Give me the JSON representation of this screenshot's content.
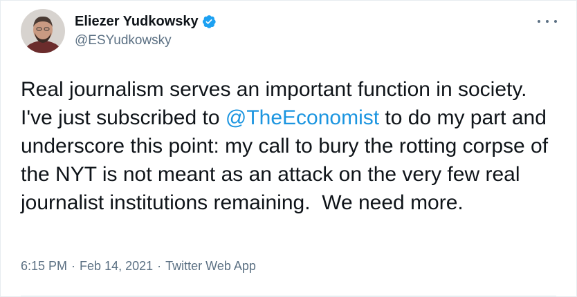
{
  "author": {
    "display_name": "Eliezer Yudkowsky",
    "handle": "@ESYudkowsky",
    "verified": true,
    "avatar_icon": "user-avatar"
  },
  "tweet": {
    "text_before": "Real journalism serves an important function in society. I've just subscribed to ",
    "mention": "@TheEconomist",
    "text_after": " to do my part and underscore this point: my call to bury the rotting corpse of the NYT is not meant as an attack on the very few real journalist institutions remaining.  We need more."
  },
  "meta": {
    "time": "6:15 PM",
    "separator": "·",
    "date": "Feb 14, 2021",
    "source": "Twitter Web App"
  },
  "icons": {
    "more": "more-options-icon",
    "verified": "verified-badge-icon"
  },
  "colors": {
    "link": "#1b95e0",
    "secondary_text": "#5b7083",
    "verified": "#1da1f2"
  }
}
